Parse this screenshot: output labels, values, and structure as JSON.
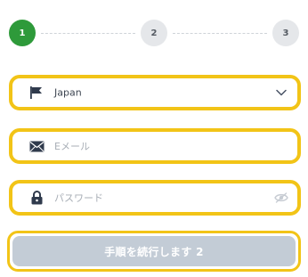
{
  "stepper": {
    "steps": [
      {
        "label": "1",
        "state": "active"
      },
      {
        "label": "2",
        "state": "inactive"
      },
      {
        "label": "3",
        "state": "inactive"
      }
    ]
  },
  "form": {
    "country": {
      "value": "Japan",
      "icon": "flag-icon",
      "trailing_icon": "chevron-down-icon"
    },
    "email": {
      "placeholder": "Eメール",
      "icon": "envelope-icon"
    },
    "password": {
      "placeholder": "パスワード",
      "icon": "lock-icon",
      "trailing_icon": "eye-off-icon"
    },
    "submit_label": "手順を続行します 2"
  },
  "colors": {
    "accent_highlight": "#f2c417",
    "step_active": "#2e9a3a",
    "step_inactive": "#e5e7ea",
    "button_disabled": "#c3ccd6",
    "icon": "#2f3a4c"
  }
}
